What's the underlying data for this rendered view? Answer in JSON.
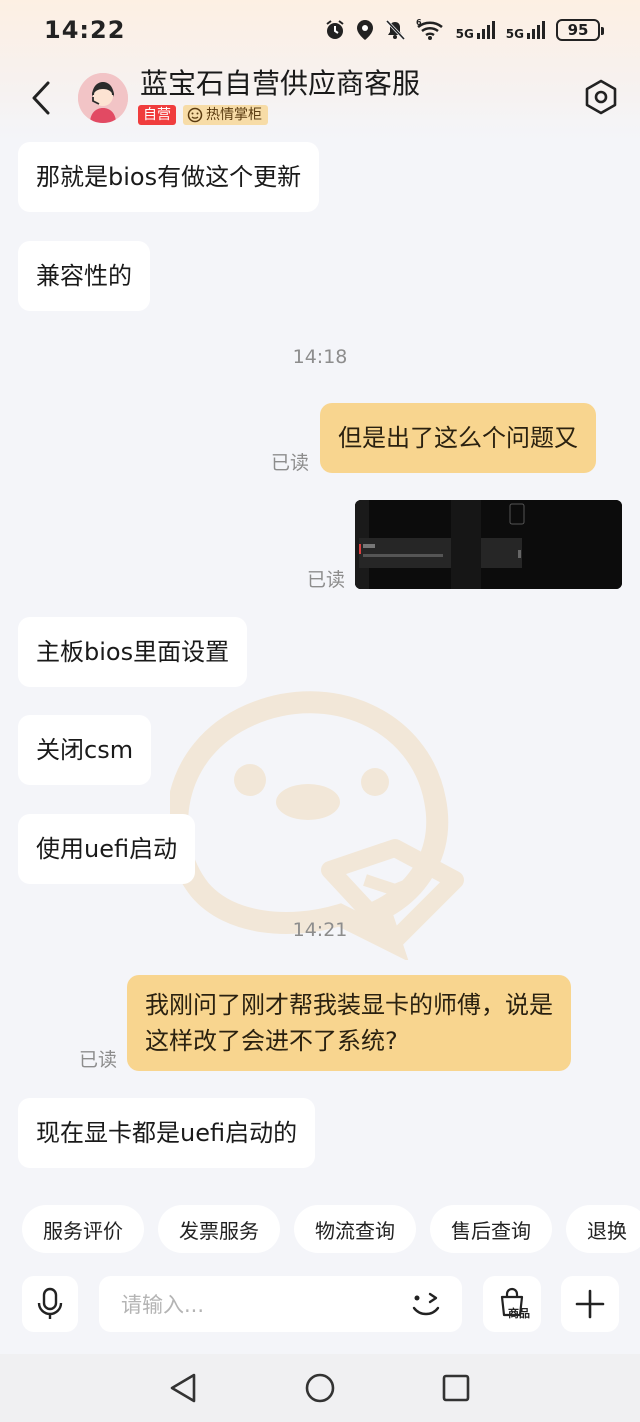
{
  "status_bar": {
    "time": "14:22",
    "net1": "5G",
    "net2": "5G",
    "wifi_sup": "6",
    "battery": "95",
    "icons": [
      "alarm-icon",
      "location-icon",
      "mute-icon",
      "wifi-icon",
      "signal-icon",
      "signal-icon",
      "battery-icon"
    ]
  },
  "header": {
    "shop_name": "蓝宝石自营供应商客服",
    "badge_self": "自营",
    "badge_warm": "热情掌柜"
  },
  "messages": [
    {
      "side": "left",
      "text": "那就是bios有做这个更新"
    },
    {
      "side": "left",
      "text": "兼容性的"
    },
    {
      "side": "center",
      "text": "14:18"
    },
    {
      "side": "right",
      "text": "但是出了这么个问题又",
      "status": "已读"
    },
    {
      "side": "right",
      "type": "image",
      "status": "已读"
    },
    {
      "side": "left",
      "text": "主板bios里面设置"
    },
    {
      "side": "left",
      "text": "关闭csm"
    },
    {
      "side": "left",
      "text": "使用uefi启动"
    },
    {
      "side": "center",
      "text": "14:21"
    },
    {
      "side": "right",
      "text_line1": "我刚问了刚才帮我装显卡的师傅，说是",
      "text_line2": "这样改了会进不了系统?",
      "status": "已读"
    },
    {
      "side": "left",
      "text": "现在显卡都是uefi启动的"
    }
  ],
  "quick_actions": [
    "服务评价",
    "发票服务",
    "物流查询",
    "售后查询",
    "退换"
  ],
  "input": {
    "placeholder": "请输入...",
    "goods_label": "商品"
  },
  "colors": {
    "own_bubble": "#f8d58f",
    "other_bubble": "#ffffff",
    "badge_self": "#f03d3d",
    "badge_warm": "#f7dca7",
    "background": "#f4f5f9"
  }
}
